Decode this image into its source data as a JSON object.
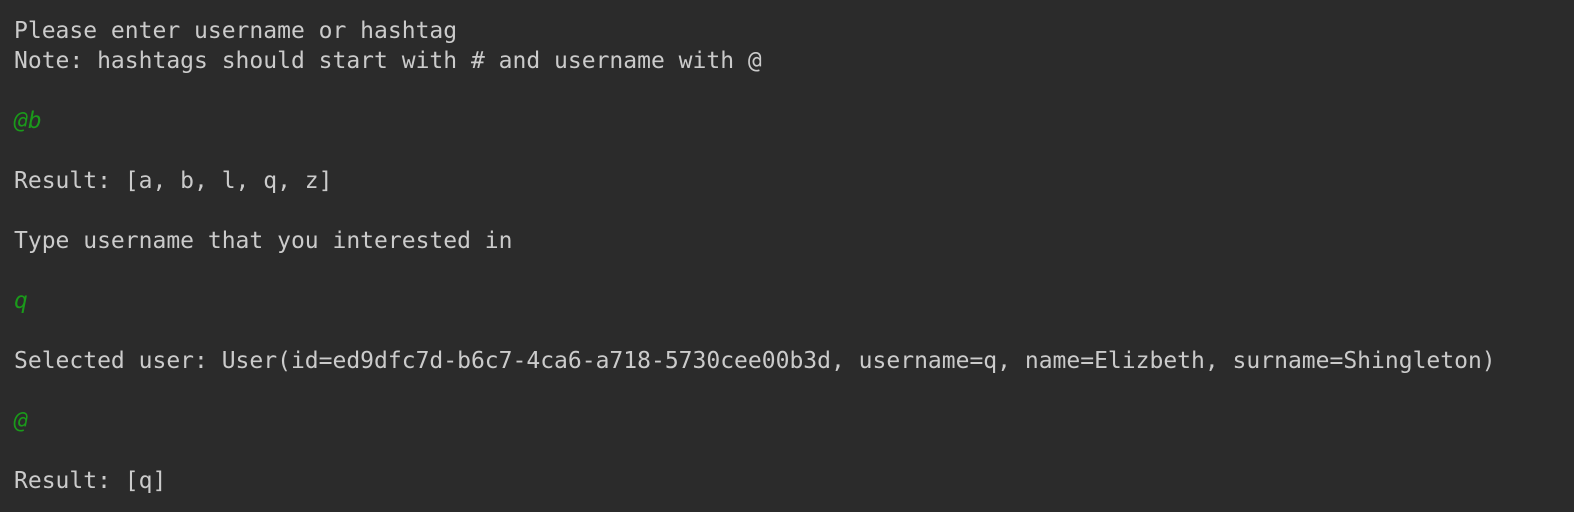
{
  "console": {
    "prompt_1": "Please enter username or hashtag",
    "prompt_2": "Note: hashtags should start with # and username with @",
    "input_1": "@b",
    "result_1": "Result: [a, b, l, q, z]",
    "prompt_3": "Type username that you interested in",
    "input_2": "q",
    "selected_user": "Selected user: User(id=ed9dfc7d-b6c7-4ca6-a718-5730cee00b3d, username=q, name=Elizbeth, surname=Shingleton)",
    "input_3": "@",
    "result_2": "Result: [q]"
  },
  "colors": {
    "background": "#2b2b2b",
    "output_text": "#cbcbcb",
    "user_input_text": "#1a9a1a"
  }
}
